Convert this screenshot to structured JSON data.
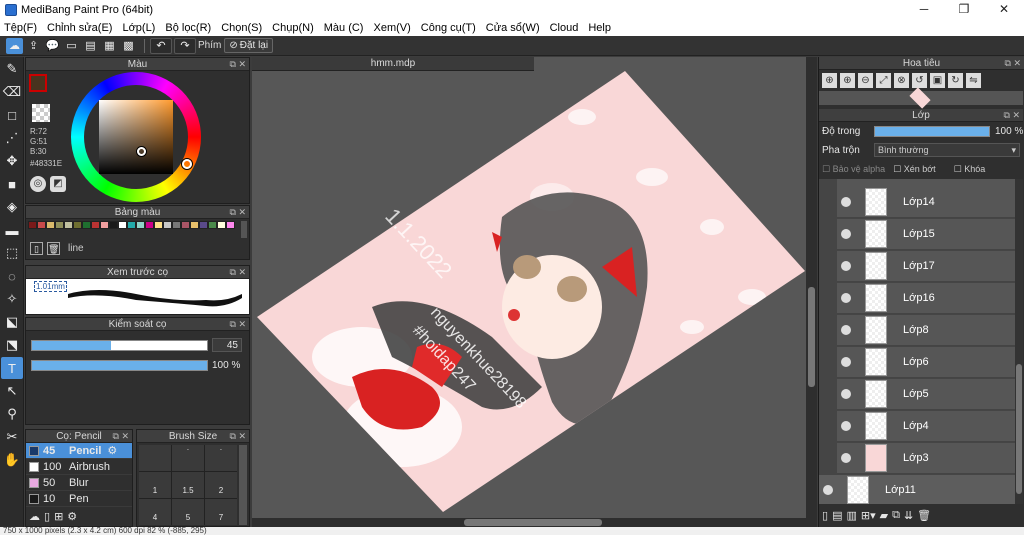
{
  "window": {
    "title": "MediBang Paint Pro (64bit)",
    "min": "─",
    "max": "❐",
    "close": "✕"
  },
  "menu": [
    "Tệp(F)",
    "Chỉnh sửa(E)",
    "Lớp(L)",
    "Bộ lọc(R)",
    "Chọn(S)",
    "Chụp(N)",
    "Màu (C)",
    "Xem(V)",
    "Công cụ(T)",
    "Cửa sổ(W)",
    "Cloud",
    "Help"
  ],
  "toolbar": {
    "shortcut_label": "Phím",
    "reset_label": "Đặt lại"
  },
  "color_panel": {
    "title": "Màu",
    "r": "R:72",
    "g": "G:51",
    "b": "B:30",
    "hex": "#48331E",
    "fg_color": "#48331E",
    "bg_color": "#ffffff"
  },
  "palette_panel": {
    "title": "Bảng màu",
    "palette_name": "line",
    "swatches": [
      "#7a1a1a",
      "#c84a4a",
      "#d9b96b",
      "#8f8f5a",
      "#c0c0a0",
      "#6e6e30",
      "#1f6f2f",
      "#b33",
      "#f2a0a0",
      "#1a1a1a",
      "#fff",
      "#2aa",
      "#8fd3c8",
      "#c08",
      "#ffe08a",
      "#c8c8c8",
      "#777",
      "#a56",
      "#e8c06a",
      "#5a4a8a",
      "#4a8a4a",
      "#ffd",
      "#f8e"
    ]
  },
  "preview_panel": {
    "title": "Xem trước cọ",
    "size_label": "1.01mm"
  },
  "control_panel": {
    "title": "Kiểm soát cọ",
    "size_value": "45",
    "size_fraction": 0.45,
    "opacity_value": "100 %",
    "opacity_fraction": 1.0
  },
  "brush_panel": {
    "title": "Cọ: Pencil",
    "items": [
      {
        "num": "45",
        "name": "Pencil",
        "color": "#1a3a6a"
      },
      {
        "num": "100",
        "name": "Airbrush",
        "color": "#ffffff"
      },
      {
        "num": "50",
        "name": "Blur",
        "color": "#e8a8e0"
      },
      {
        "num": "10",
        "name": "Pen",
        "color": "#1a1a1a"
      }
    ]
  },
  "brushsize_panel": {
    "title": "Brush Size",
    "labels": [
      "1",
      "1.5",
      "2",
      "4",
      "5",
      "7"
    ]
  },
  "document": {
    "tab": "hmm.mdp",
    "art_texts": {
      "date": "1.1.2022",
      "credit1": "nguyenkhue28198",
      "credit2": "#hoidap247"
    }
  },
  "navigator": {
    "title": "Hoa tiêu"
  },
  "layers_panel": {
    "title": "Lớp",
    "opacity_label": "Độ trong",
    "opacity_value": "100 %",
    "opacity_fraction": 1.0,
    "blend_label": "Pha trộn",
    "blend_value": "Bình thường",
    "protect_alpha": "Bảo vệ alpha",
    "clipping": "Xén bớt",
    "lock": "Khóa",
    "layers": [
      "Lớp14",
      "Lớp15",
      "Lớp17",
      "Lớp16",
      "Lớp8",
      "Lớp6",
      "Lớp5",
      "Lớp4",
      "Lớp3",
      "Lớp11"
    ]
  },
  "status": {
    "text": "750 x 1000 pixels (2.3 x 4.2 cm)  600 dpi  82 %  (-885, 295)"
  }
}
